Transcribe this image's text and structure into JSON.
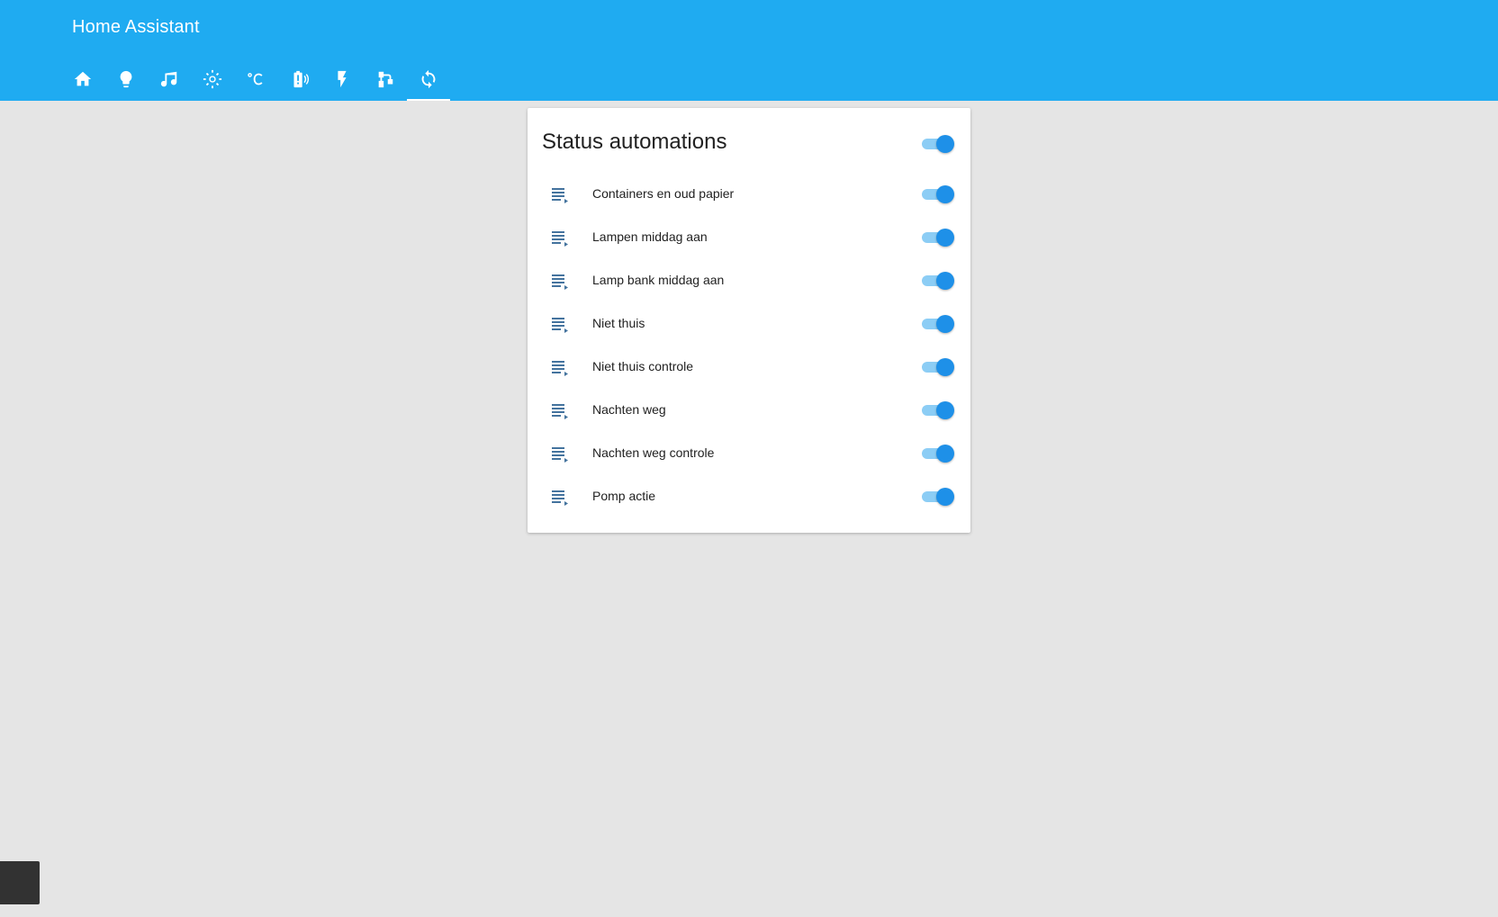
{
  "app": {
    "title": "Home Assistant"
  },
  "tabs": [
    {
      "icon": "home-icon",
      "active": false
    },
    {
      "icon": "lightbulb-icon",
      "active": false
    },
    {
      "icon": "music-note-icon",
      "active": false
    },
    {
      "icon": "sun-icon",
      "active": false
    },
    {
      "icon": "thermometer-celsius-icon",
      "active": false
    },
    {
      "icon": "battery-signal-icon",
      "active": false
    },
    {
      "icon": "flash-icon",
      "active": false
    },
    {
      "icon": "water-pump-icon",
      "active": false
    },
    {
      "icon": "refresh-icon",
      "active": true
    }
  ],
  "card": {
    "title": "Status automations",
    "all_on": true,
    "items": [
      {
        "label": "Containers en oud papier",
        "on": true
      },
      {
        "label": "Lampen middag aan",
        "on": true
      },
      {
        "label": "Lamp bank middag aan",
        "on": true
      },
      {
        "label": "Niet thuis",
        "on": true
      },
      {
        "label": "Niet thuis controle",
        "on": true
      },
      {
        "label": "Nachten weg",
        "on": true
      },
      {
        "label": "Nachten weg controle",
        "on": true
      },
      {
        "label": "Pomp actie",
        "on": true
      }
    ]
  },
  "colors": {
    "header": "#1fabf1",
    "toggle_knob": "#1e90e8",
    "toggle_track": "#8ccdf5",
    "automation_icon": "#44739e",
    "background": "#e5e5e5"
  }
}
